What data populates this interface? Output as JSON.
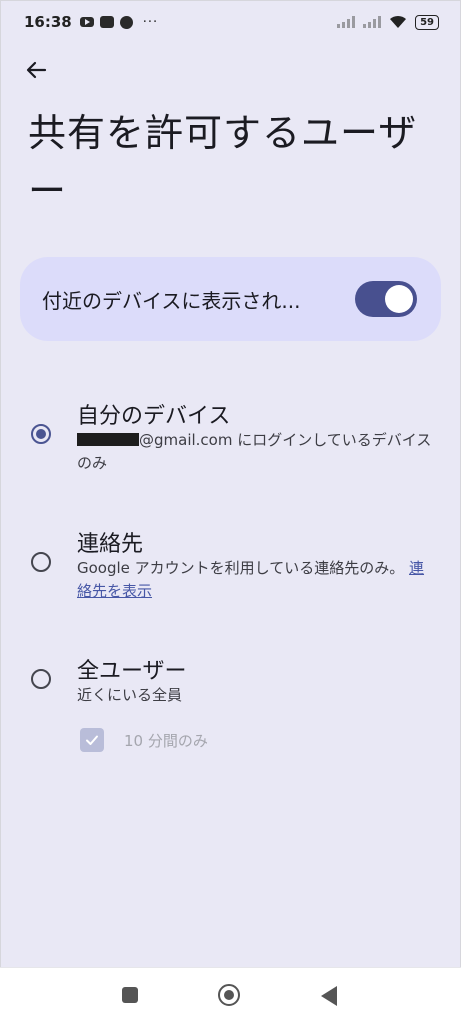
{
  "status_bar": {
    "time": "16:38",
    "overflow_indicator": "···",
    "battery": "59",
    "icons": [
      "youtube-icon",
      "line-icon",
      "line-icon",
      "signal-icon",
      "signal-icon",
      "wifi-icon",
      "battery-icon"
    ]
  },
  "header": {
    "back_icon": "back-arrow-icon",
    "title": "共有を許可するユーザー"
  },
  "visibility": {
    "label": "付近のデバイスに表示され...",
    "toggle_on": true
  },
  "options": [
    {
      "title": "自分のデバイス",
      "desc_before": "",
      "desc_email_suffix": "@gmail.com にログインしているデバイスのみ",
      "selected": true
    },
    {
      "title": "連絡先",
      "desc": "Google アカウントを利用している連絡先のみ。",
      "link": "連絡先を表示",
      "selected": false
    },
    {
      "title": "全ユーザー",
      "desc": "近くにいる全員",
      "selected": false
    }
  ],
  "timer": {
    "label": "10 分間のみ",
    "checked": true,
    "disabled": true
  },
  "nav_bar": {
    "buttons": [
      "recents-icon",
      "home-icon",
      "back-icon"
    ]
  },
  "colors": {
    "background": "#e9e8f5",
    "card": "#dcdcfa",
    "accent": "#4b5592",
    "link": "#4757a6"
  }
}
